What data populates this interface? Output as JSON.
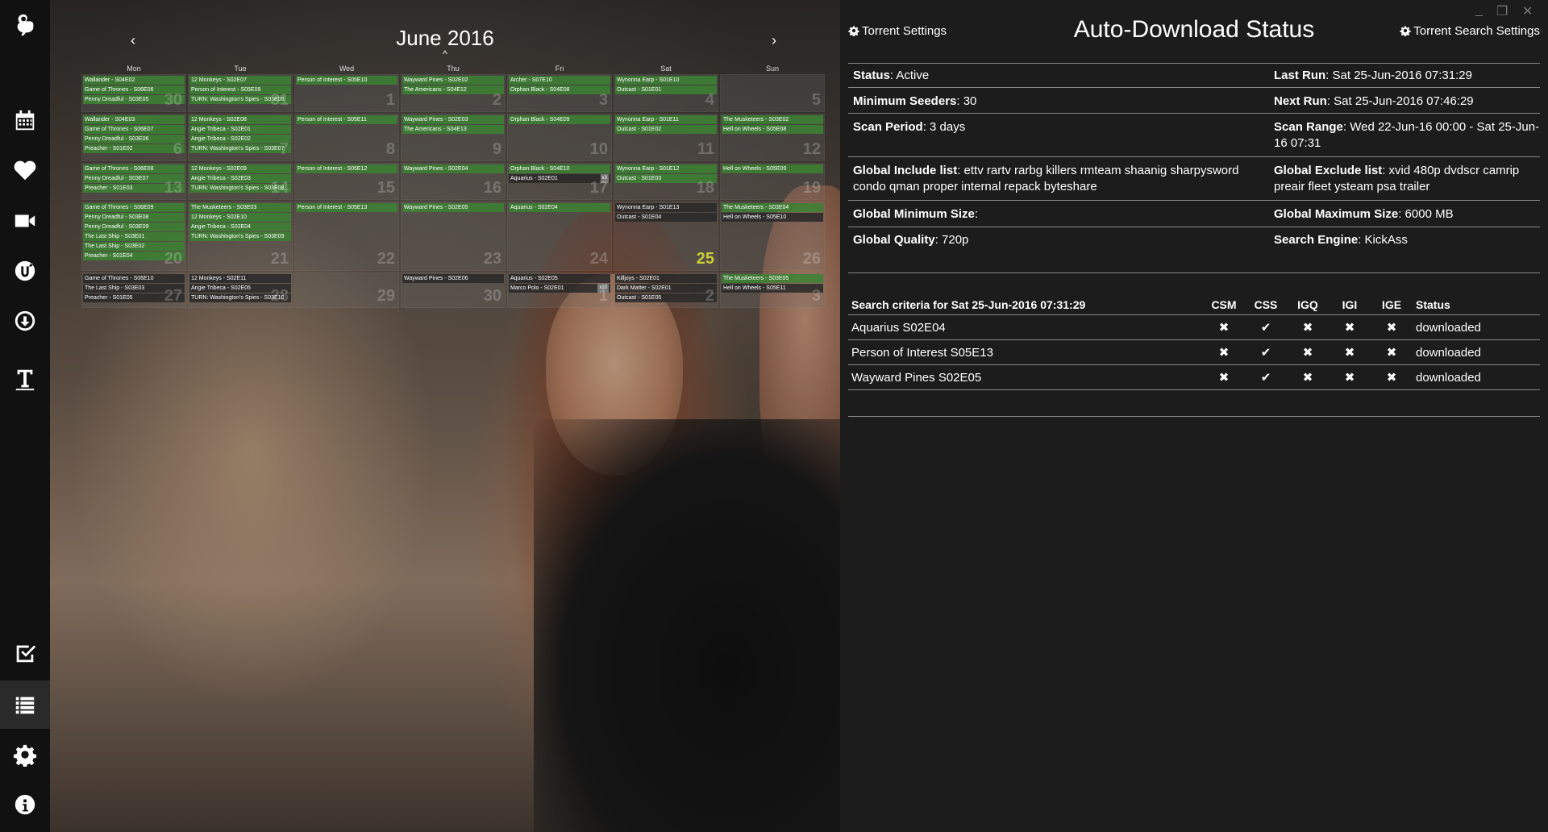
{
  "sidebar": {
    "items": [
      "app-logo",
      "calendar",
      "favorites",
      "movies",
      "utorrent",
      "downloads",
      "subtitles",
      "todo",
      "list",
      "settings",
      "about"
    ]
  },
  "calendar": {
    "title": "June 2016",
    "prev": "‹",
    "next": "›",
    "up": "^",
    "dow": [
      "Mon",
      "Tue",
      "Wed",
      "Thu",
      "Fri",
      "Sat",
      "Sun"
    ],
    "weeks": [
      {
        "days": [
          {
            "num": "30",
            "events": [
              {
                "t": "Wallander - S04E02",
                "c": "g"
              },
              {
                "t": "Game of Thrones - S06E06",
                "c": "g"
              },
              {
                "t": "Penny Dreadful - S03E05",
                "c": "g"
              }
            ]
          },
          {
            "num": "31",
            "events": [
              {
                "t": "12 Monkeys - S02E07",
                "c": "g"
              },
              {
                "t": "Person of Interest - S05E09",
                "c": "g"
              },
              {
                "t": "TURN: Washington's Spies - S03E06",
                "c": "g"
              }
            ]
          },
          {
            "num": "1",
            "events": [
              {
                "t": "Person of Interest - S05E10",
                "c": "g"
              }
            ]
          },
          {
            "num": "2",
            "events": [
              {
                "t": "Wayward Pines - S02E02",
                "c": "g"
              },
              {
                "t": "The Americans - S04E12",
                "c": "g"
              }
            ]
          },
          {
            "num": "3",
            "events": [
              {
                "t": "Archer - S07E10",
                "c": "g"
              },
              {
                "t": "Orphan Black - S04E08",
                "c": "g"
              }
            ]
          },
          {
            "num": "4",
            "events": [
              {
                "t": "Wynonna Earp - S01E10",
                "c": "g"
              },
              {
                "t": "Outcast - S01E01",
                "c": "g"
              }
            ]
          },
          {
            "num": "5",
            "events": []
          }
        ]
      },
      {
        "days": [
          {
            "num": "6",
            "events": [
              {
                "t": "Wallander - S04E03",
                "c": "g"
              },
              {
                "t": "Game of Thrones - S06E07",
                "c": "g"
              },
              {
                "t": "Penny Dreadful - S03E06",
                "c": "g"
              },
              {
                "t": "Preacher - S01E02",
                "c": "g"
              }
            ]
          },
          {
            "num": "7",
            "events": [
              {
                "t": "12 Monkeys - S02E08",
                "c": "g"
              },
              {
                "t": "Angie Tribeca - S02E01",
                "c": "g"
              },
              {
                "t": "Angie Tribeca - S02E02",
                "c": "g"
              },
              {
                "t": "TURN: Washington's Spies - S03E07",
                "c": "g"
              }
            ]
          },
          {
            "num": "8",
            "events": [
              {
                "t": "Person of Interest - S05E11",
                "c": "g"
              }
            ]
          },
          {
            "num": "9",
            "events": [
              {
                "t": "Wayward Pines - S02E03",
                "c": "g"
              },
              {
                "t": "The Americans - S04E13",
                "c": "g"
              }
            ]
          },
          {
            "num": "10",
            "events": [
              {
                "t": "Orphan Black - S04E09",
                "c": "g"
              }
            ]
          },
          {
            "num": "11",
            "events": [
              {
                "t": "Wynonna Earp - S01E11",
                "c": "g"
              },
              {
                "t": "Outcast - S01E02",
                "c": "g"
              }
            ]
          },
          {
            "num": "12",
            "events": [
              {
                "t": "The Musketeers - S03E02",
                "c": "g"
              },
              {
                "t": "Hell on Wheels - S05E08",
                "c": "g"
              }
            ]
          }
        ]
      },
      {
        "days": [
          {
            "num": "13",
            "events": [
              {
                "t": "Game of Thrones - S06E08",
                "c": "g"
              },
              {
                "t": "Penny Dreadful - S03E07",
                "c": "g"
              },
              {
                "t": "Preacher - S01E03",
                "c": "g"
              }
            ]
          },
          {
            "num": "14",
            "events": [
              {
                "t": "12 Monkeys - S02E09",
                "c": "g"
              },
              {
                "t": "Angie Tribeca - S02E03",
                "c": "g"
              },
              {
                "t": "TURN: Washington's Spies - S03E08",
                "c": "g"
              }
            ]
          },
          {
            "num": "15",
            "events": [
              {
                "t": "Person of Interest - S05E12",
                "c": "g"
              }
            ]
          },
          {
            "num": "16",
            "events": [
              {
                "t": "Wayward Pines - S02E04",
                "c": "g"
              }
            ]
          },
          {
            "num": "17",
            "events": [
              {
                "t": "Orphan Black - S04E10",
                "c": "g"
              },
              {
                "t": "Aquarius - S02E01",
                "c": "d",
                "b": "x3"
              }
            ]
          },
          {
            "num": "18",
            "events": [
              {
                "t": "Wynonna Earp - S01E12",
                "c": "g"
              },
              {
                "t": "Outcast - S01E03",
                "c": "g"
              }
            ]
          },
          {
            "num": "19",
            "events": [
              {
                "t": "Hell on Wheels - S05E09",
                "c": "g"
              }
            ]
          }
        ]
      },
      {
        "days": [
          {
            "num": "20",
            "events": [
              {
                "t": "Game of Thrones - S06E09",
                "c": "g"
              },
              {
                "t": "Penny Dreadful - S03E08",
                "c": "g"
              },
              {
                "t": "Penny Dreadful - S03E09",
                "c": "g"
              },
              {
                "t": "The Last Ship - S03E01",
                "c": "g"
              },
              {
                "t": "The Last Ship - S03E02",
                "c": "g"
              },
              {
                "t": "Preacher - S01E04",
                "c": "g"
              }
            ]
          },
          {
            "num": "21",
            "events": [
              {
                "t": "The Musketeers - S03E03",
                "c": "g"
              },
              {
                "t": "12 Monkeys - S02E10",
                "c": "g"
              },
              {
                "t": "Angie Tribeca - S02E04",
                "c": "g"
              },
              {
                "t": "TURN: Washington's Spies - S03E09",
                "c": "g"
              }
            ]
          },
          {
            "num": "22",
            "events": [
              {
                "t": "Person of Interest - S05E13",
                "c": "g"
              }
            ]
          },
          {
            "num": "23",
            "events": [
              {
                "t": "Wayward Pines - S02E05",
                "c": "g"
              }
            ]
          },
          {
            "num": "24",
            "events": [
              {
                "t": "Aquarius - S02E04",
                "c": "g"
              }
            ]
          },
          {
            "num": "25",
            "today": true,
            "events": [
              {
                "t": "Wynonna Earp - S01E13",
                "c": "d"
              },
              {
                "t": "Outcast - S01E04",
                "c": "d"
              }
            ]
          },
          {
            "num": "26",
            "events": [
              {
                "t": "The Musketeers - S03E04",
                "c": "g"
              },
              {
                "t": "Hell on Wheels - S05E10",
                "c": "d"
              }
            ]
          }
        ]
      },
      {
        "days": [
          {
            "num": "27",
            "events": [
              {
                "t": "Game of Thrones - S06E10",
                "c": "d"
              },
              {
                "t": "The Last Ship - S03E03",
                "c": "d"
              },
              {
                "t": "Preacher - S01E05",
                "c": "d"
              }
            ]
          },
          {
            "num": "28",
            "events": [
              {
                "t": "12 Monkeys - S02E11",
                "c": "d"
              },
              {
                "t": "Angie Tribeca - S02E05",
                "c": "d"
              },
              {
                "t": "TURN: Washington's Spies - S03E10",
                "c": "d"
              }
            ]
          },
          {
            "num": "29",
            "events": []
          },
          {
            "num": "30",
            "events": [
              {
                "t": "Wayward Pines - S02E06",
                "c": "d"
              }
            ]
          },
          {
            "num": "1",
            "events": [
              {
                "t": "Aquarius - S02E05",
                "c": "d"
              },
              {
                "t": "Marco Polo - S02E01",
                "c": "d",
                "b": "x10"
              }
            ]
          },
          {
            "num": "2",
            "events": [
              {
                "t": "Killjoys - S02E01",
                "c": "d"
              },
              {
                "t": "Dark Matter - S02E01",
                "c": "d"
              },
              {
                "t": "Outcast - S01E05",
                "c": "d"
              }
            ]
          },
          {
            "num": "3",
            "events": [
              {
                "t": "The Musketeers - S03E05",
                "c": "g"
              },
              {
                "t": "Hell on Wheels - S05E11",
                "c": "d"
              }
            ]
          }
        ]
      }
    ]
  },
  "panel": {
    "left_link": "Torrent Settings",
    "right_link": "Torrent Search Settings",
    "title": "Auto-Download Status",
    "win_min": "_",
    "win_max": "❐",
    "win_close": "✕",
    "fields": {
      "status_label": "Status",
      "status_value": ": Active",
      "lastrun_label": "Last Run",
      "lastrun_value": ": Sat 25-Jun-2016 07:31:29",
      "minseed_label": "Minimum Seeders",
      "minseed_value": ": 30",
      "nextrun_label": "Next Run",
      "nextrun_value": ": Sat 25-Jun-2016 07:46:29",
      "scanperiod_label": "Scan Period",
      "scanperiod_value": ": 3 days",
      "scanrange_label": "Scan Range",
      "scanrange_value": ": Wed 22-Jun-16 00:00 - Sat 25-Jun-16 07:31",
      "include_label": "Global Include list",
      "include_value": ": ettv rartv rarbg killers rmteam shaanig sharpysword condo qman proper internal repack byteshare",
      "exclude_label": "Global Exclude list",
      "exclude_value": ": xvid 480p dvdscr camrip preair fleet ysteam psa trailer",
      "minsize_label": "Global Minimum Size",
      "minsize_value": ":",
      "maxsize_label": "Global Maximum Size",
      "maxsize_value": ": 6000 MB",
      "quality_label": "Global Quality",
      "quality_value": ": 720p",
      "engine_label": "Search Engine",
      "engine_value": ": KickAss"
    },
    "criteria": {
      "header": [
        "Search criteria for Sat 25-Jun-2016 07:31:29",
        "CSM",
        "CSS",
        "IGQ",
        "IGI",
        "IGE",
        "Status"
      ],
      "rows": [
        {
          "name": "Aquarius S02E04",
          "csm": "✖",
          "css": "✔",
          "igq": "✖",
          "igi": "✖",
          "ige": "✖",
          "status": "downloaded"
        },
        {
          "name": "Person of Interest S05E13",
          "csm": "✖",
          "css": "✔",
          "igq": "✖",
          "igi": "✖",
          "ige": "✖",
          "status": "downloaded"
        },
        {
          "name": "Wayward Pines S02E05",
          "csm": "✖",
          "css": "✔",
          "igq": "✖",
          "igi": "✖",
          "ige": "✖",
          "status": "downloaded"
        }
      ]
    }
  }
}
